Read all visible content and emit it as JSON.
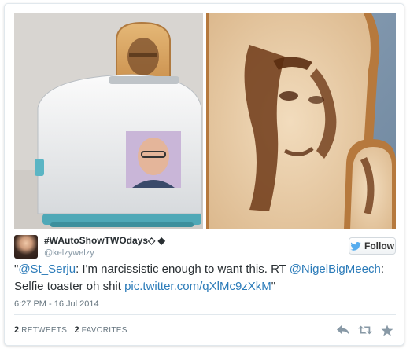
{
  "user": {
    "display_name": "#WAutoShowTWOdays◇ ◆",
    "handle": "@kelzywelzy"
  },
  "follow_button": {
    "label": "Follow",
    "icon": "twitter-bird-icon"
  },
  "tweet": {
    "quote_open": "\"",
    "mention_1": "@St_Serju",
    "text_1": ": I'm narcissistic enough to want this. RT ",
    "mention_2": "@NigelBigMeech",
    "text_2": ": Selfie toaster oh shit ",
    "link": "pic.twitter.com/qXlMc9zXkM",
    "quote_close": "\""
  },
  "timestamp": "6:27 PM - 16 Jul 2014",
  "stats": {
    "retweets_count": "2",
    "retweets_label": "RETWEETS",
    "favorites_count": "2",
    "favorites_label": "FAVORITES"
  },
  "actions": [
    "reply-icon",
    "retweet-icon",
    "favorite-icon"
  ],
  "colors": {
    "link": "#2b7bb9",
    "twitter_blue": "#55acee",
    "text": "#292f33",
    "muted": "#8899a6"
  }
}
